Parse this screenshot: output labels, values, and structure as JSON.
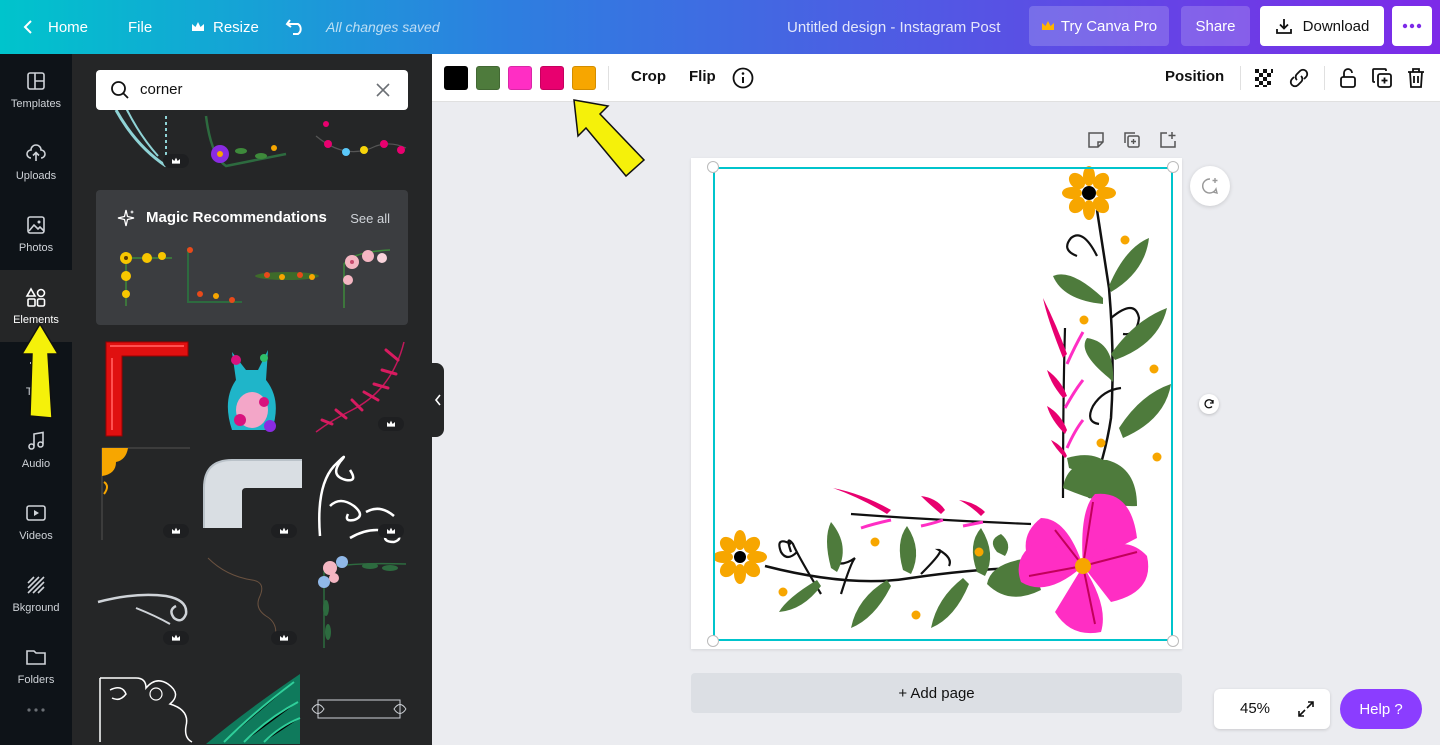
{
  "topbar": {
    "home_label": "Home",
    "file_label": "File",
    "resize_label": "Resize",
    "saved_status": "All changes saved",
    "design_title": "Untitled design - Instagram Post",
    "try_pro_label": "Try Canva Pro",
    "share_label": "Share",
    "download_label": "Download"
  },
  "rail": {
    "items": [
      {
        "label": "Templates"
      },
      {
        "label": "Uploads"
      },
      {
        "label": "Photos"
      },
      {
        "label": "Elements"
      },
      {
        "label": "Text"
      },
      {
        "label": "Audio"
      },
      {
        "label": "Videos"
      },
      {
        "label": "Bkground"
      },
      {
        "label": "Folders"
      }
    ]
  },
  "panel": {
    "search_value": "corner",
    "magic_title": "Magic Recommendations",
    "magic_see_all": "See all"
  },
  "toolbar": {
    "colors": [
      "#000000",
      "#4e7b3c",
      "#ff2ec4",
      "#e8006f",
      "#f7a600"
    ],
    "crop_label": "Crop",
    "flip_label": "Flip",
    "position_label": "Position"
  },
  "canvas": {
    "add_page_label": "+ Add page"
  },
  "footer": {
    "zoom_label": "45%",
    "help_label": "Help  ?"
  },
  "theme": {
    "accent": "#8b3dff",
    "selection": "#00c4cc"
  }
}
